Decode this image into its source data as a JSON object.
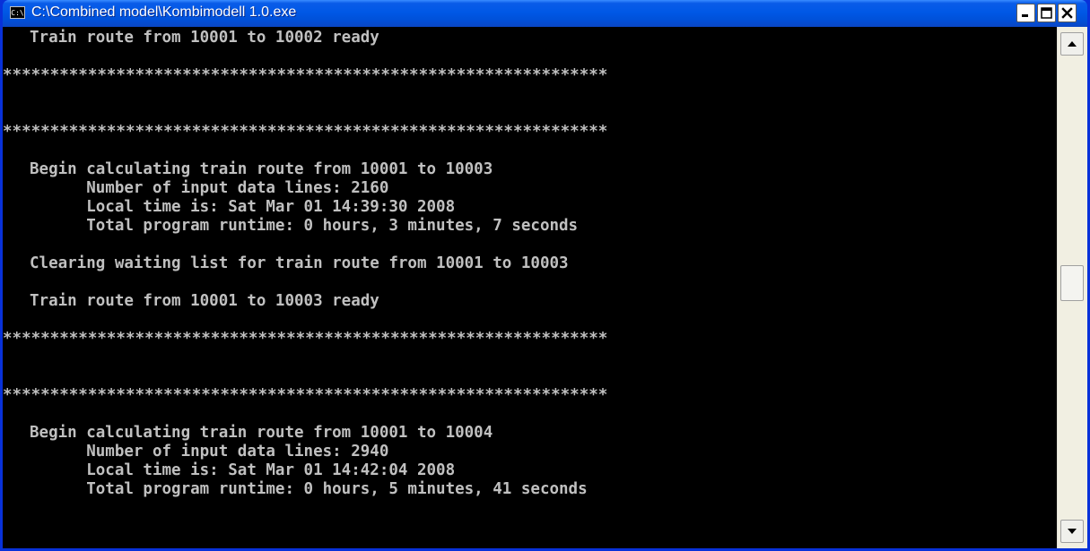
{
  "window": {
    "title": "C:\\Combined model\\Kombimodell 1.0.exe",
    "icon_text": "C:\\"
  },
  "titlebar_buttons": {
    "minimize": "minimize-icon",
    "maximize": "maximize-icon",
    "close": "close-icon"
  },
  "console": {
    "lines": [
      "Train route from 10001 to 10002 ready",
      "",
      "****************************************************************",
      "",
      "",
      "****************************************************************",
      "",
      "Begin calculating train route from 10001 to 10003",
      "      Number of input data lines: 2160",
      "      Local time is: Sat Mar 01 14:39:30 2008",
      "      Total program runtime: 0 hours, 3 minutes, 7 seconds",
      "",
      "Clearing waiting list for train route from 10001 to 10003",
      "",
      "Train route from 10001 to 10003 ready",
      "",
      "****************************************************************",
      "",
      "",
      "****************************************************************",
      "",
      "Begin calculating train route from 10001 to 10004",
      "      Number of input data lines: 2940",
      "      Local time is: Sat Mar 01 14:42:04 2008",
      "      Total program runtime: 0 hours, 5 minutes, 41 seconds"
    ]
  },
  "scrollbar": {
    "position": 0.5
  },
  "colors": {
    "titlebar": "#0058e6",
    "console_bg": "#000000",
    "console_text": "#c0c0c0",
    "close_button": "#e0452b"
  }
}
